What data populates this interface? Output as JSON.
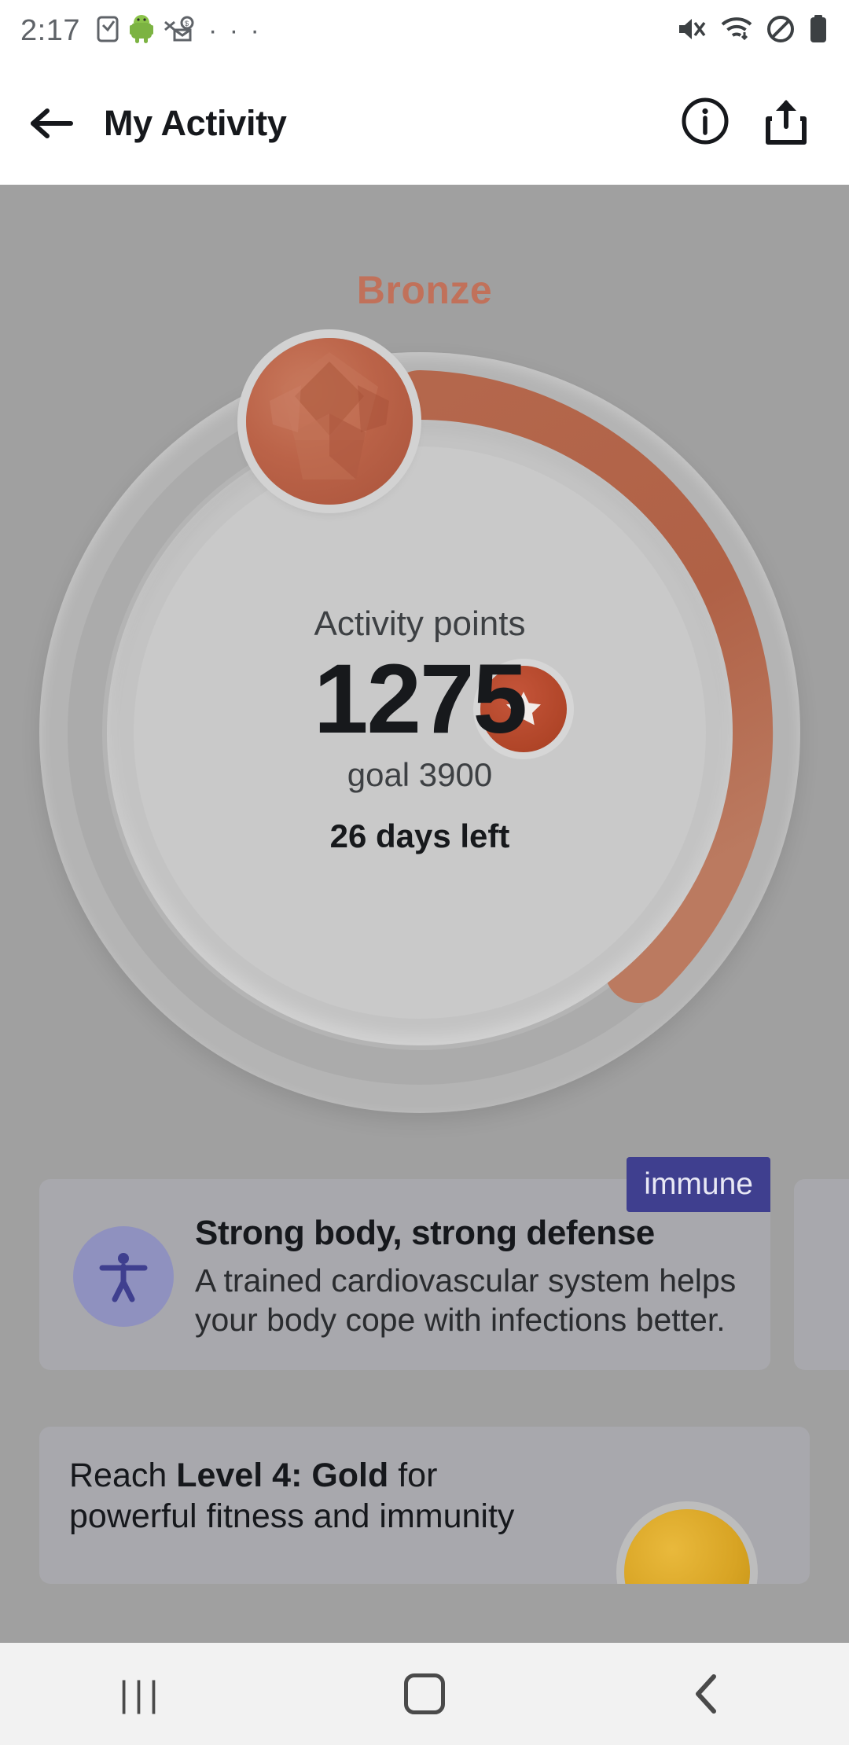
{
  "statusbar": {
    "clock": "2:17",
    "left_icons": [
      "sim-card-icon",
      "android-robot-icon",
      "key-mail-icon",
      "overflow-dots-icon"
    ],
    "right_icons": [
      "mute-icon",
      "wifi-icon",
      "do-not-disturb-icon",
      "battery-full-icon"
    ],
    "dots": "· · ·"
  },
  "appbar": {
    "back_icon": "arrow-left-icon",
    "title": "My Activity",
    "info_icon": "info-circle-icon",
    "share_icon": "share-icon"
  },
  "activity": {
    "level_label": "Bronze",
    "level_color": "#c1715a",
    "points_label": "Activity points",
    "points_value": "1275",
    "goal_text": "goal 3900",
    "days_left": "26 days left",
    "gem_icon": "bronze-gem-icon",
    "milestone_icon": "star-icon",
    "progress_percent": 33
  },
  "tip_card": {
    "tag": "immune",
    "tag_color": "#3f3f8f",
    "avatar_icon": "accessibility-person-icon",
    "title": "Strong body, strong defense",
    "body": "A trained cardiovascular system helps your body cope with infections better."
  },
  "reach_card": {
    "prefix": "Reach ",
    "level": "Level 4: Gold",
    "suffix": " for",
    "line2_prefix": "powerful fitness and immunity",
    "medal_icon": "gold-medal-icon"
  },
  "navbar": {
    "recents_icon": "|||",
    "home_icon": "home-square-icon",
    "back_icon": "chevron-left-icon"
  }
}
